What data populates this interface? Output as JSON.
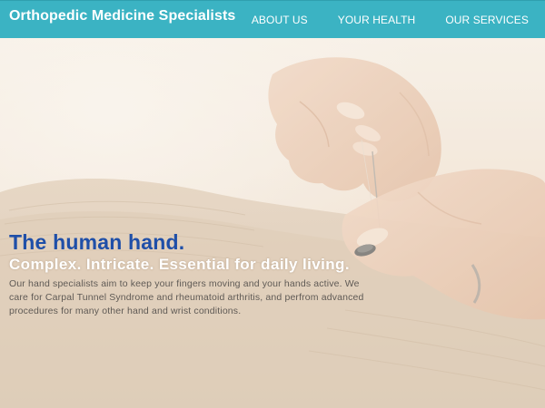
{
  "header": {
    "brand": "Orthopedic Medicine Specialists",
    "nav": [
      {
        "label": "ABOUT US"
      },
      {
        "label": "YOUR HEALTH"
      },
      {
        "label": "OUR SERVICES"
      }
    ]
  },
  "hero": {
    "title": "The human hand.",
    "subtitle": "Complex. Intricate. Essential for daily living.",
    "body": "Our hand specialists aim to keep your fingers moving and your hands active. We care for Carpal Tunnel Syndrome and rheumatoid arthritis, and perfrom advanced procedures for many other hand and wrist conditions.",
    "image_subject": "hands-sewing-button-photo"
  },
  "colors": {
    "navbar": "#3bb3c3",
    "title": "#1f4fa8",
    "subtitle": "#ffffff",
    "body_text": "#5f5a55"
  }
}
